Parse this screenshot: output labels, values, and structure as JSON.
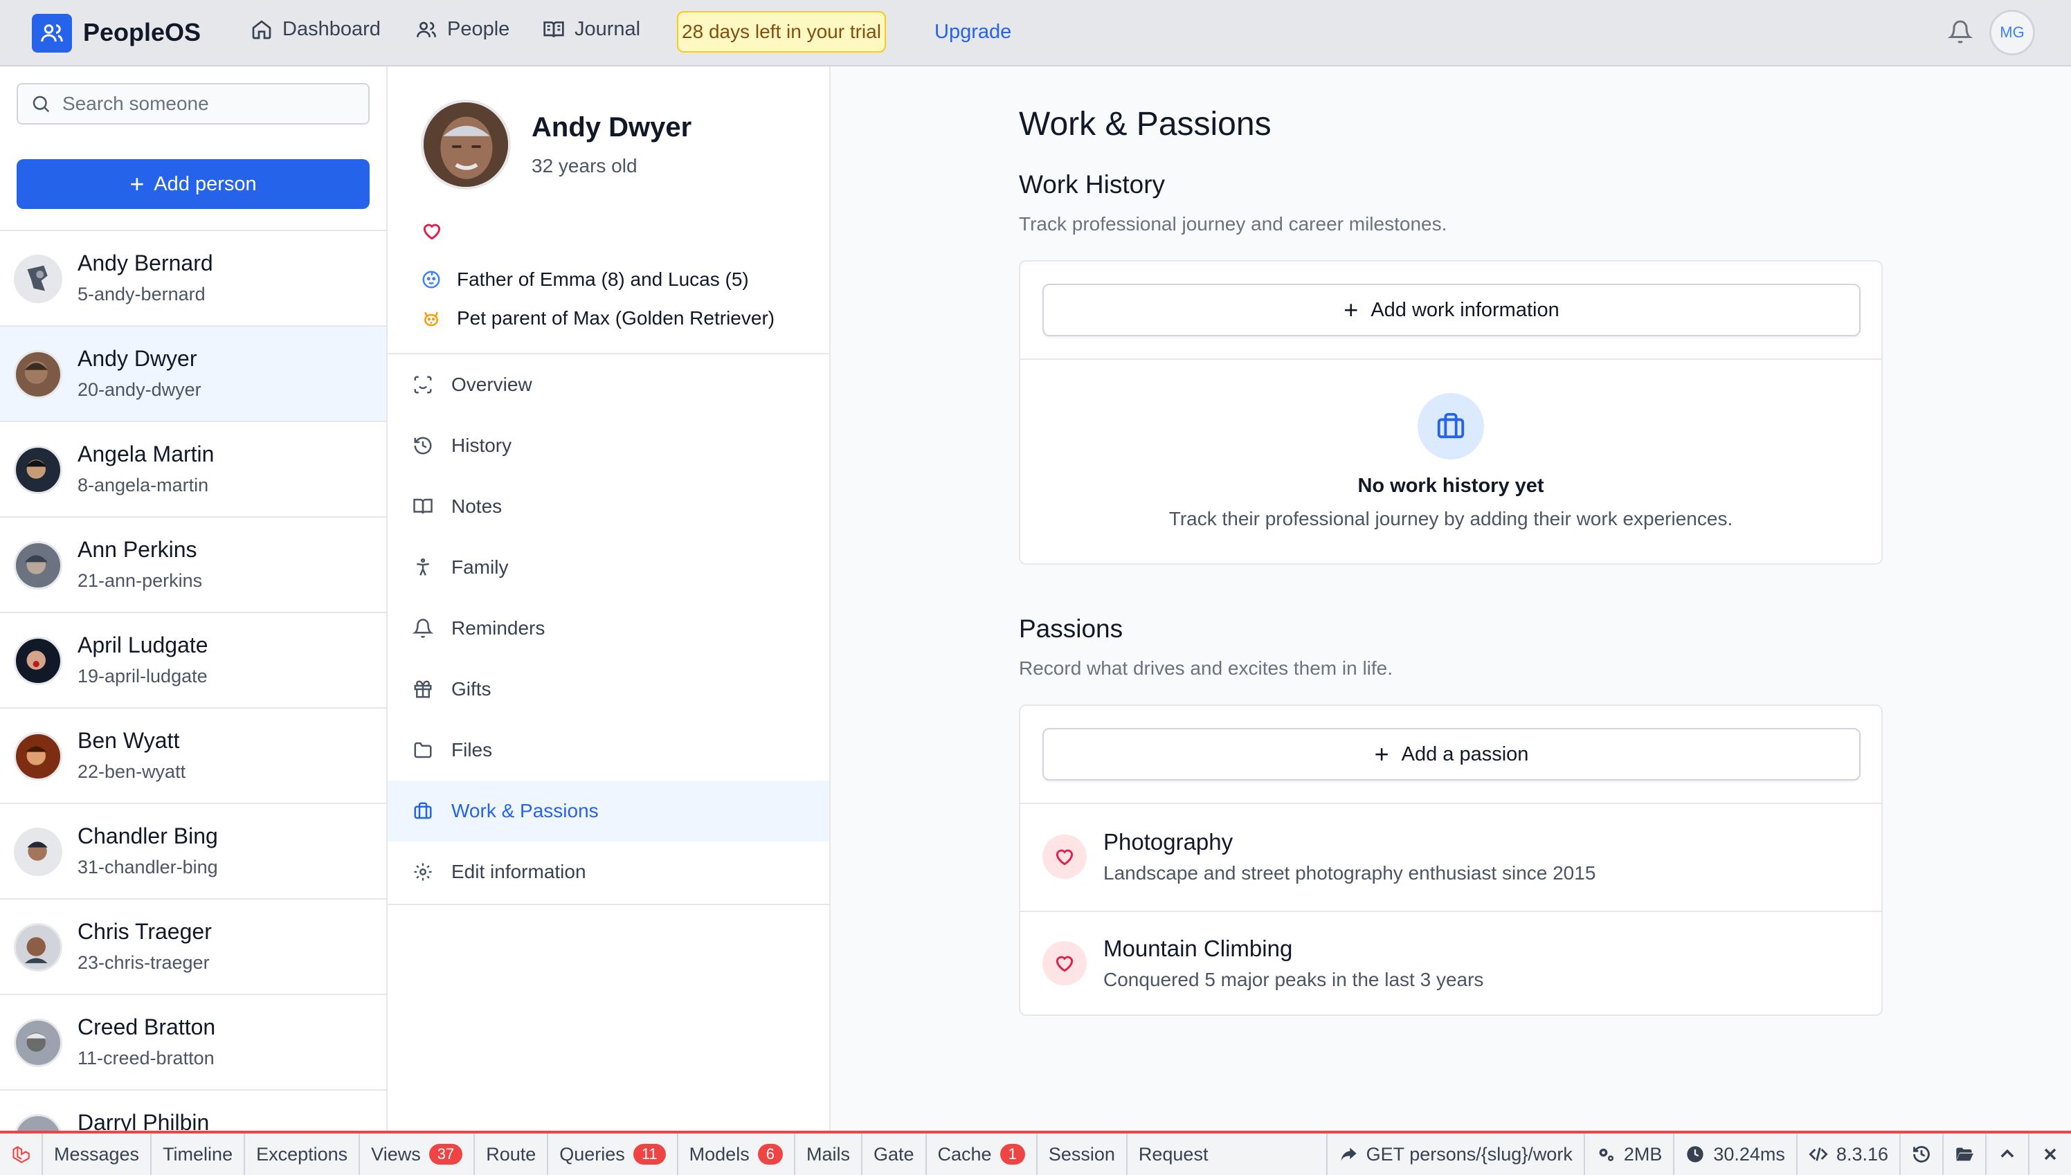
{
  "header": {
    "app_name": "PeopleOS",
    "nav": [
      {
        "label": "Dashboard",
        "icon": "home-icon"
      },
      {
        "label": "People",
        "icon": "people-icon"
      },
      {
        "label": "Journal",
        "icon": "book-icon"
      }
    ],
    "trial_text": "28 days left in your trial",
    "upgrade_label": "Upgrade",
    "user_initials": "MG"
  },
  "sidebar": {
    "search_placeholder": "Search someone",
    "add_person_label": "Add person",
    "people": [
      {
        "name": "Andy Bernard",
        "slug": "5-andy-bernard",
        "active": false
      },
      {
        "name": "Andy Dwyer",
        "slug": "20-andy-dwyer",
        "active": true
      },
      {
        "name": "Angela Martin",
        "slug": "8-angela-martin",
        "active": false
      },
      {
        "name": "Ann Perkins",
        "slug": "21-ann-perkins",
        "active": false
      },
      {
        "name": "April Ludgate",
        "slug": "19-april-ludgate",
        "active": false
      },
      {
        "name": "Ben Wyatt",
        "slug": "22-ben-wyatt",
        "active": false
      },
      {
        "name": "Chandler Bing",
        "slug": "31-chandler-bing",
        "active": false
      },
      {
        "name": "Chris Traeger",
        "slug": "23-chris-traeger",
        "active": false
      },
      {
        "name": "Creed Bratton",
        "slug": "11-creed-bratton",
        "active": false
      },
      {
        "name": "Darryl Philbin",
        "slug": "",
        "active": false
      }
    ]
  },
  "profile": {
    "name": "Andy Dwyer",
    "age": "32 years old",
    "facts": [
      {
        "text": "Father of Emma (8) and Lucas (5)",
        "icon": "baby-icon"
      },
      {
        "text": "Pet parent of Max (Golden Retriever)",
        "icon": "dog-icon"
      }
    ],
    "menu": [
      {
        "label": "Overview",
        "icon": "scan-face-icon",
        "active": false
      },
      {
        "label": "History",
        "icon": "history-icon",
        "active": false
      },
      {
        "label": "Notes",
        "icon": "book-open-icon",
        "active": false
      },
      {
        "label": "Family",
        "icon": "person-standing-icon",
        "active": false
      },
      {
        "label": "Reminders",
        "icon": "bell-icon",
        "active": false
      },
      {
        "label": "Gifts",
        "icon": "gift-icon",
        "active": false
      },
      {
        "label": "Files",
        "icon": "folder-icon",
        "active": false
      },
      {
        "label": "Work & Passions",
        "icon": "briefcase-icon",
        "active": true
      },
      {
        "label": "Edit information",
        "icon": "gear-icon",
        "active": false
      }
    ]
  },
  "main": {
    "title": "Work & Passions",
    "work": {
      "heading": "Work History",
      "description": "Track professional journey and career milestones.",
      "add_label": "Add work information",
      "empty_title": "No work history yet",
      "empty_text": "Track their professional journey by adding their work experiences."
    },
    "passions": {
      "heading": "Passions",
      "description": "Record what drives and excites them in life.",
      "add_label": "Add a passion",
      "items": [
        {
          "title": "Photography",
          "description": "Landscape and street photography enthusiast since 2015"
        },
        {
          "title": "Mountain Climbing",
          "description": "Conquered 5 major peaks in the last 3 years"
        }
      ]
    }
  },
  "debugbar": {
    "tabs": [
      {
        "label": "Messages",
        "badge": ""
      },
      {
        "label": "Timeline",
        "badge": ""
      },
      {
        "label": "Exceptions",
        "badge": ""
      },
      {
        "label": "Views",
        "badge": "37"
      },
      {
        "label": "Route",
        "badge": ""
      },
      {
        "label": "Queries",
        "badge": "11"
      },
      {
        "label": "Models",
        "badge": "6"
      },
      {
        "label": "Mails",
        "badge": ""
      },
      {
        "label": "Gate",
        "badge": ""
      },
      {
        "label": "Cache",
        "badge": "1"
      },
      {
        "label": "Session",
        "badge": ""
      },
      {
        "label": "Request",
        "badge": ""
      }
    ],
    "route": "GET persons/{slug}/work",
    "memory": "2MB",
    "time": "30.24ms",
    "php_version": "8.3.16"
  },
  "colors": {
    "accent": "#2563eb",
    "trial_bg": "#fef9c3",
    "debug_red": "#ef4444",
    "passion_pink": "#e11d48"
  }
}
